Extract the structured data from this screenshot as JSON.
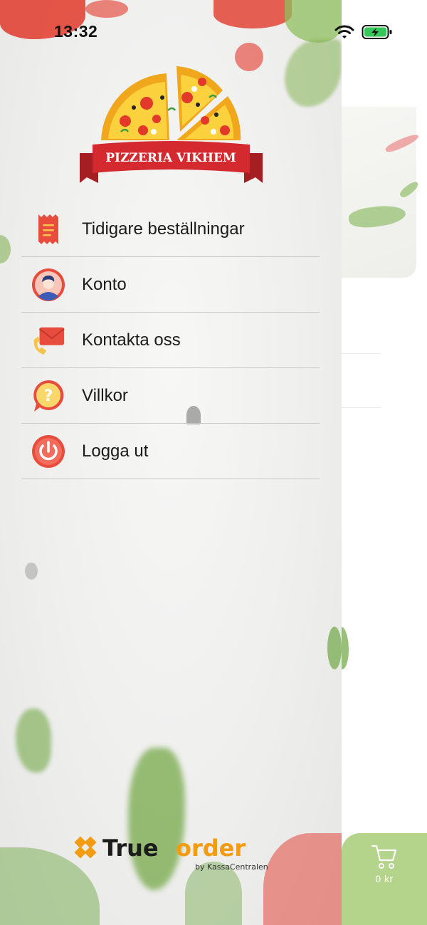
{
  "status_bar": {
    "time": "13:32"
  },
  "drawer": {
    "logo_text": "PIZZERIA VIKHEM",
    "menu": [
      {
        "label": "Tidigare beställningar",
        "icon": "receipt-icon"
      },
      {
        "label": "Konto",
        "icon": "user-avatar-icon"
      },
      {
        "label": "Kontakta oss",
        "icon": "mail-phone-icon"
      },
      {
        "label": "Villkor",
        "icon": "question-bubble-icon"
      },
      {
        "label": "Logga ut",
        "icon": "power-icon"
      }
    ],
    "footer": {
      "brand_true": "True",
      "brand_order": "order",
      "byline": "by KassaCentralen"
    }
  },
  "cart": {
    "total": "0 kr",
    "icon": "shopping-cart-icon"
  },
  "colors": {
    "accent_red": "#e84c3d",
    "cart_green": "#b3d48a",
    "brand_orange": "#f39c12"
  }
}
